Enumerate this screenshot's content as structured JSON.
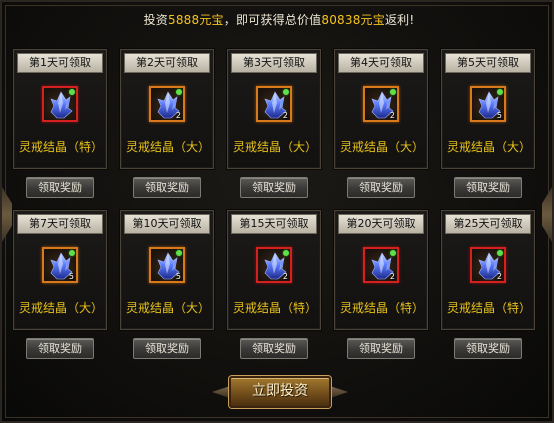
{
  "banner": {
    "prefix": "投资",
    "amount": "5888元宝",
    "middle": "，即可获得总价值",
    "total": "80838元宝",
    "suffix": "返利!"
  },
  "claim_label": "领取奖励",
  "invest_button": "立即投资",
  "cards": [
    {
      "day": "第1天可领取",
      "item": "灵戒结晶（特）",
      "frame": "red",
      "qty": ""
    },
    {
      "day": "第2天可领取",
      "item": "灵戒结晶（大）",
      "frame": "orange",
      "qty": "2"
    },
    {
      "day": "第3天可领取",
      "item": "灵戒结晶（大）",
      "frame": "orange",
      "qty": "2"
    },
    {
      "day": "第4天可领取",
      "item": "灵戒结晶（大）",
      "frame": "orange",
      "qty": "2"
    },
    {
      "day": "第5天可领取",
      "item": "灵戒结晶（大）",
      "frame": "orange",
      "qty": "5"
    },
    {
      "day": "第7天可领取",
      "item": "灵戒结晶（大）",
      "frame": "orange",
      "qty": "5"
    },
    {
      "day": "第10天可领取",
      "item": "灵戒结晶（大）",
      "frame": "orange",
      "qty": "5"
    },
    {
      "day": "第15天可领取",
      "item": "灵戒结晶（特）",
      "frame": "red",
      "qty": "2"
    },
    {
      "day": "第20天可领取",
      "item": "灵戒结晶（特）",
      "frame": "red",
      "qty": "2"
    },
    {
      "day": "第25天可领取",
      "item": "灵戒结晶（特）",
      "frame": "red",
      "qty": "2"
    }
  ],
  "colors": {
    "accent_gold": "#f6c31f",
    "item_name": "#e7c11a",
    "frame_orange": "#d8791c",
    "frame_red": "#d4201e",
    "ready_dot": "#5ee04a"
  },
  "icons": {
    "item": "blue-crystal-icon",
    "status": "green-dot-icon"
  }
}
